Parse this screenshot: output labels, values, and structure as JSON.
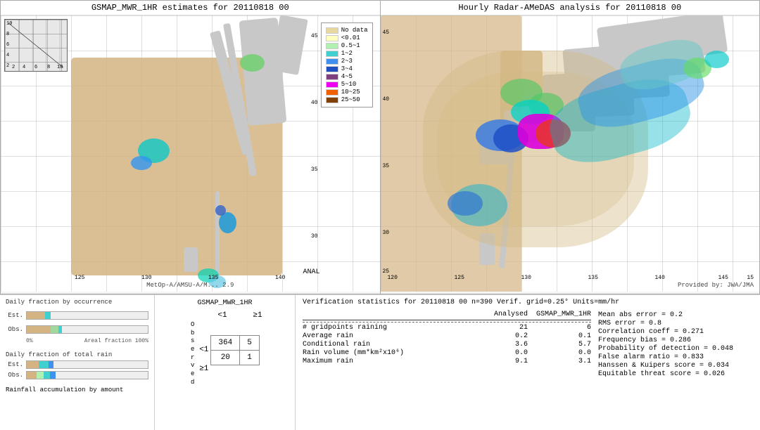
{
  "left_map": {
    "title": "GSMAP_MWR_1HR estimates for 20110818 00",
    "anal_label": "ANAL",
    "watermark": "MetOp-A/AMSU-A/M... 2.9"
  },
  "right_map": {
    "title": "Hourly Radar-AMeDAS analysis for 20110818 00",
    "watermark": "Provided by: JWA/JMA"
  },
  "legend": {
    "title": "",
    "items": [
      {
        "label": "No data",
        "color": "#e8d8a0"
      },
      {
        "label": "<0.01",
        "color": "#ffffc0"
      },
      {
        "label": "0.5~1",
        "color": "#b0f0b0"
      },
      {
        "label": "1~2",
        "color": "#40d0d0"
      },
      {
        "label": "2~3",
        "color": "#4090f0"
      },
      {
        "label": "3~4",
        "color": "#2050c0"
      },
      {
        "label": "4~5",
        "color": "#804080"
      },
      {
        "label": "5~10",
        "color": "#f000f0"
      },
      {
        "label": "10~25",
        "color": "#f06000"
      },
      {
        "label": "25~50",
        "color": "#804000"
      }
    ]
  },
  "charts": {
    "occurrence_title": "Daily fraction by occurrence",
    "rain_title": "Daily fraction of total rain",
    "est_label": "Est.",
    "obs_label": "Obs.",
    "pct_0": "0%",
    "pct_100": "Areal fraction   100%",
    "rainfall_label": "Rainfall accumulation by amount"
  },
  "contingency": {
    "title": "GSMAP_MWR_1HR",
    "col_less1": "<1",
    "col_ge1": "≥1",
    "row_less1": "<1",
    "row_ge1": "≥1",
    "observed_label": "O\nb\ns\ne\nr\nv\ne\nd",
    "val_tl": "364",
    "val_tr": "5",
    "val_bl": "20",
    "val_br": "1"
  },
  "verification": {
    "title": "Verification statistics for 20110818 00  n=390  Verif. grid=0.25°  Units=mm/hr",
    "headers": {
      "metric": "",
      "analysed": "Analysed",
      "gsmap": "GSMAP_MWR_1HR"
    },
    "dashes": "----------------------------------------------------",
    "rows": [
      {
        "metric": "# gridpoints raining",
        "analysed": "21",
        "gsmap": "6"
      },
      {
        "metric": "Average rain",
        "analysed": "0.2",
        "gsmap": "0.1"
      },
      {
        "metric": "Conditional rain",
        "analysed": "3.6",
        "gsmap": "5.7"
      },
      {
        "metric": "Rain volume (mm*km²x10⁶)",
        "analysed": "0.0",
        "gsmap": "0.0"
      },
      {
        "metric": "Maximum rain",
        "analysed": "9.1",
        "gsmap": "3.1"
      }
    ],
    "right_stats": [
      "Mean abs error = 0.2",
      "RMS error = 0.8",
      "Correlation coeff = 0.271",
      "Frequency bias = 0.286",
      "Probability of detection = 0.048",
      "False alarm ratio = 0.833",
      "Hanssen & Kuipers score = 0.034",
      "Equitable threat score = 0.026"
    ]
  }
}
